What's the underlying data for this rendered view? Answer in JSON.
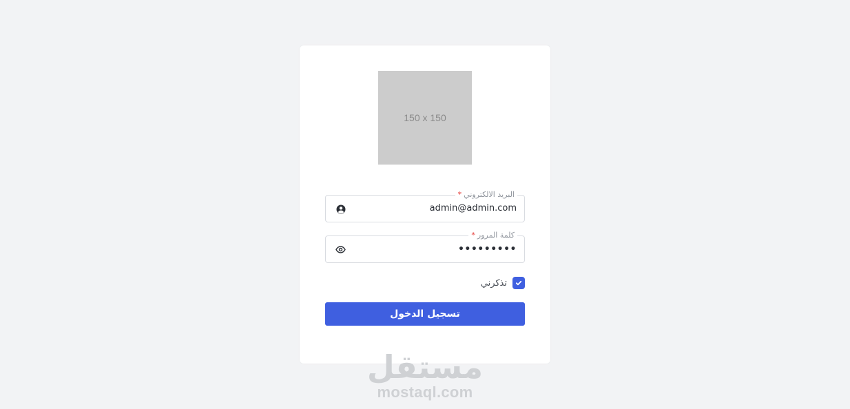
{
  "logo_placeholder": "150 x 150",
  "email": {
    "label": "البريد الالكتروني",
    "required_mark": "*",
    "value": "admin@admin.com",
    "icon": "user-circle-icon"
  },
  "password": {
    "label": "كلمة المرور",
    "required_mark": "*",
    "value": "•••••••••",
    "icon": "eye-icon"
  },
  "remember": {
    "label": "تذكرني",
    "checked": true
  },
  "login_button": "تسجيل الدخول",
  "watermark": {
    "arabic": "مستقل",
    "latin": "mostaql.com"
  },
  "colors": {
    "accent": "#3f5fe0",
    "background": "#f2f3f5",
    "required": "#e53935"
  }
}
